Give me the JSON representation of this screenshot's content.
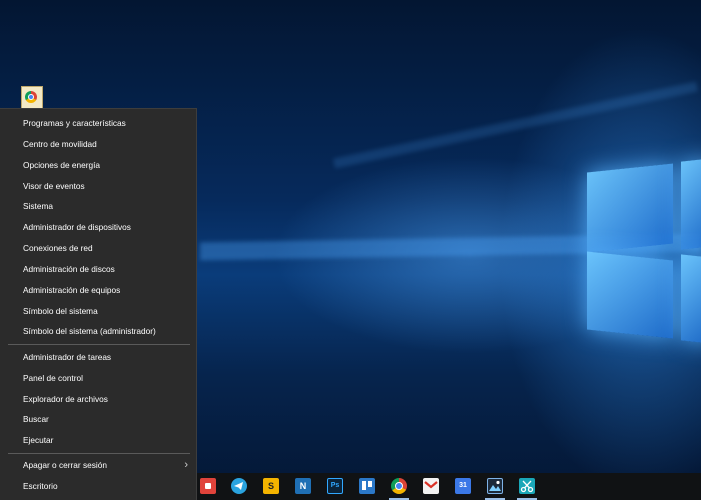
{
  "menu": {
    "items_group1": [
      {
        "label": "Programas y características"
      },
      {
        "label": "Centro de movilidad"
      },
      {
        "label": "Opciones de energía"
      },
      {
        "label": "Visor de eventos"
      },
      {
        "label": "Sistema"
      },
      {
        "label": "Administrador de dispositivos"
      },
      {
        "label": "Conexiones de red"
      },
      {
        "label": "Administración de discos"
      },
      {
        "label": "Administración de equipos"
      },
      {
        "label": "Símbolo del sistema"
      },
      {
        "label": "Símbolo del sistema (administrador)"
      }
    ],
    "items_group2": [
      {
        "label": "Administrador de tareas"
      },
      {
        "label": "Panel de control"
      },
      {
        "label": "Explorador de archivos"
      },
      {
        "label": "Buscar"
      },
      {
        "label": "Ejecutar"
      }
    ],
    "shutdown": {
      "label": "Apagar o cerrar sesión",
      "chevron": "›"
    },
    "desktop": {
      "label": "Escritorio"
    }
  },
  "taskbar": {
    "icons": [
      {
        "name": "app-red-icon"
      },
      {
        "name": "telegram-icon"
      },
      {
        "name": "slides-icon",
        "text": "S"
      },
      {
        "name": "notes-n-icon",
        "text": "N"
      },
      {
        "name": "photoshop-icon",
        "text": "Ps"
      },
      {
        "name": "trello-icon"
      },
      {
        "name": "chrome-icon"
      },
      {
        "name": "gmail-icon"
      },
      {
        "name": "calendar-icon",
        "text": "31"
      },
      {
        "name": "image-editor-icon"
      },
      {
        "name": "scissors-icon"
      }
    ]
  },
  "colors": {
    "menu_bg": "#2b2b2b",
    "menu_text": "#ffffff",
    "taskbar_bg": "#101214",
    "accent": "#1e8fff"
  }
}
